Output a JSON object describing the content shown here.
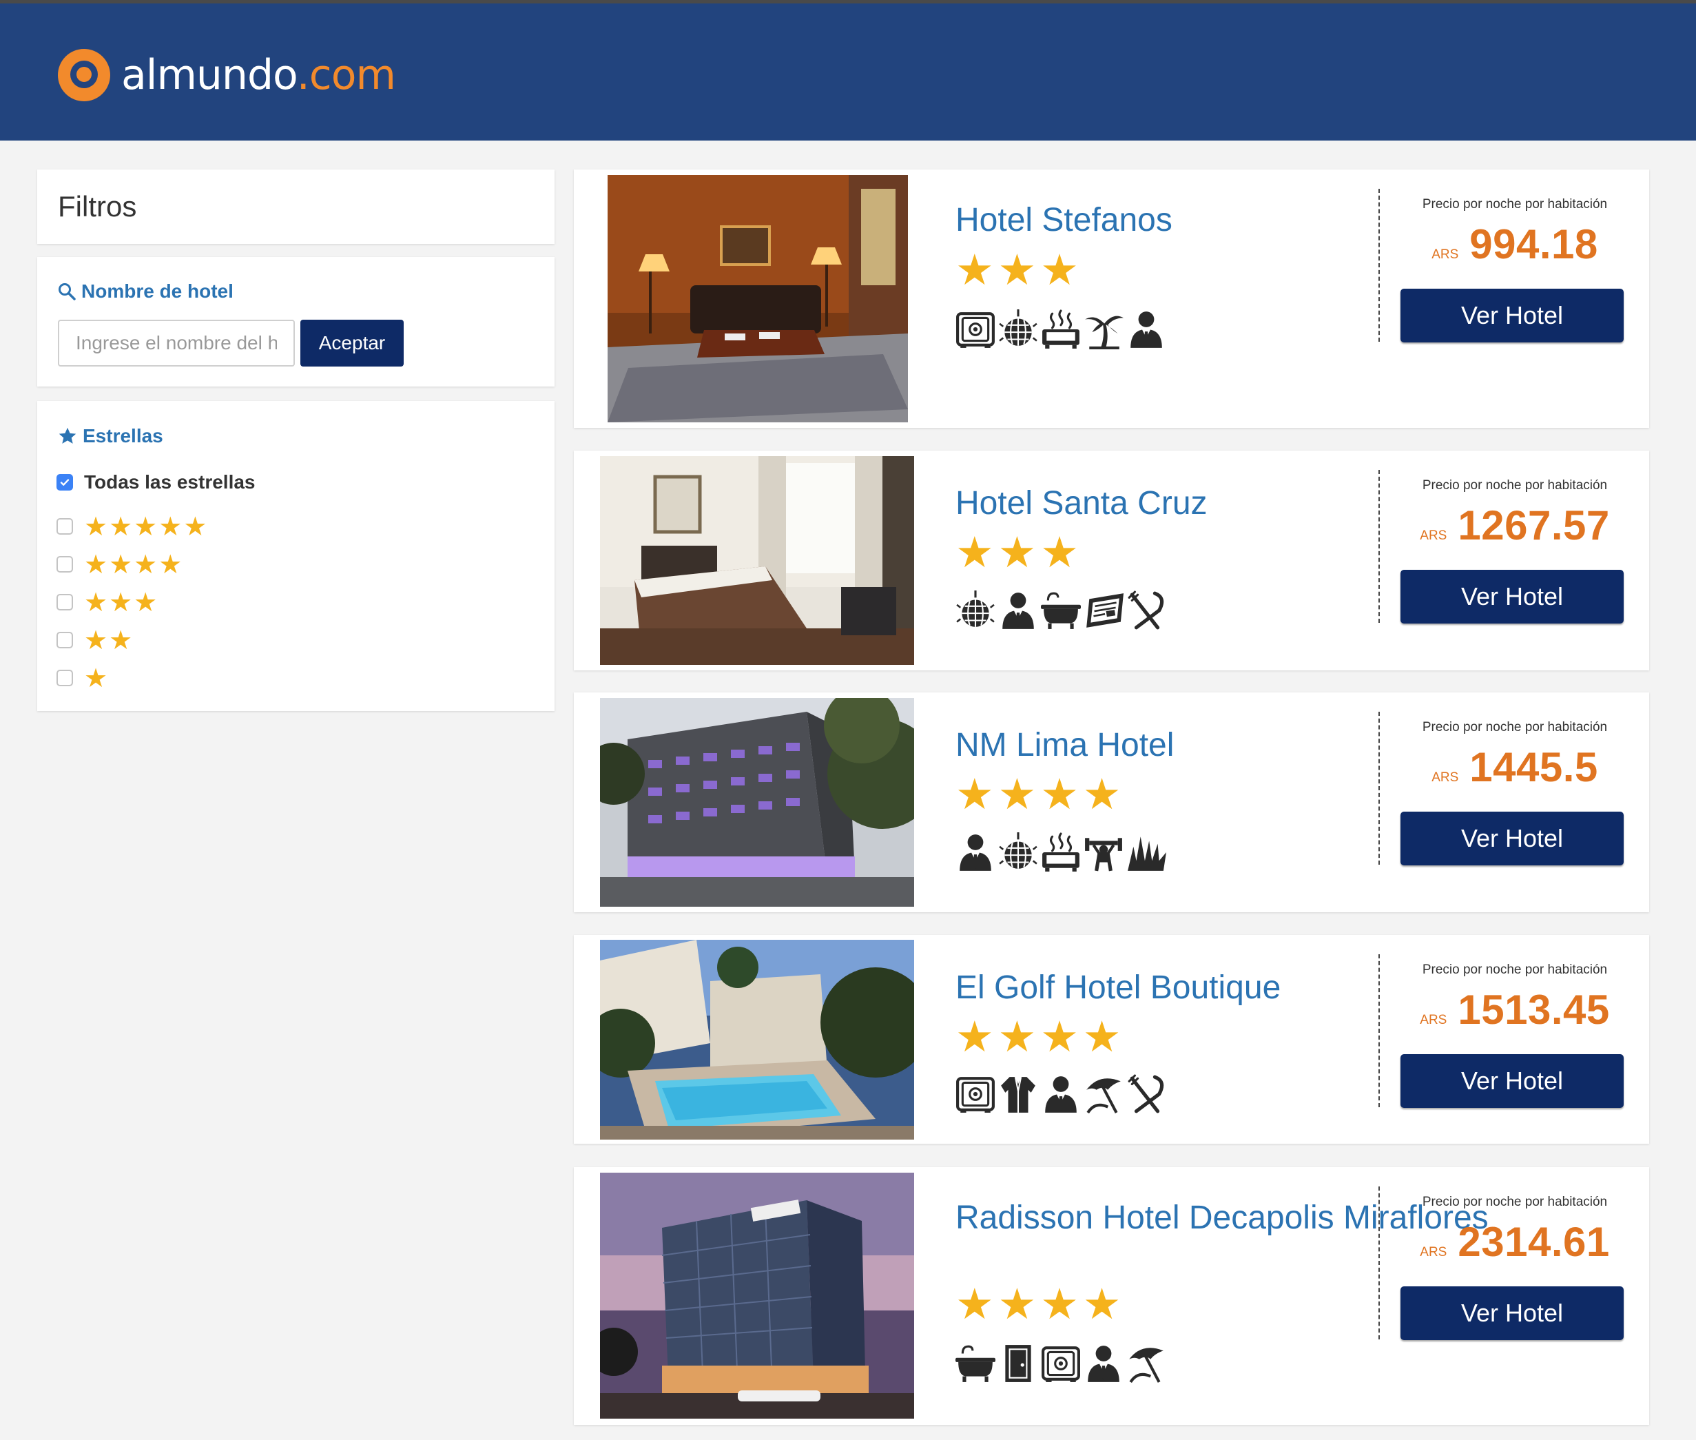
{
  "brand": {
    "logo_white": "almundo",
    "logo_orange": ".com",
    "accent": "#f28a2c",
    "header_bg": "#22447e"
  },
  "filters": {
    "title": "Filtros",
    "hotel_name": {
      "title": "Nombre de hotel",
      "placeholder": "Ingrese el nombre del hotel",
      "value": "",
      "button": "Aceptar"
    },
    "stars": {
      "title": "Estrellas",
      "all_label": "Todas las estrellas",
      "all_checked": true,
      "options": [
        {
          "stars": 5,
          "checked": false
        },
        {
          "stars": 4,
          "checked": false
        },
        {
          "stars": 3,
          "checked": false
        },
        {
          "stars": 2,
          "checked": false
        },
        {
          "stars": 1,
          "checked": false
        }
      ]
    }
  },
  "price_label": "Precio por noche por habitación",
  "button_label": "Ver Hotel",
  "hotels": [
    {
      "name": "Hotel Stefanos",
      "stars": 3,
      "currency": "ARS",
      "price": "994.18",
      "amenities": [
        "safe-icon",
        "disco-ball-icon",
        "hot-tub-icon",
        "palm-tree-icon",
        "businessman-icon"
      ]
    },
    {
      "name": "Hotel Santa Cruz",
      "stars": 3,
      "currency": "ARS",
      "price": "1267.57",
      "amenities": [
        "disco-ball-icon",
        "businessman-icon",
        "bathtub-icon",
        "newspaper-icon",
        "restaurant-icon"
      ]
    },
    {
      "name": "NM Lima Hotel",
      "stars": 4,
      "currency": "ARS",
      "price": "1445.5",
      "amenities": [
        "businessman-icon",
        "disco-ball-icon",
        "hot-tub-icon",
        "gym-icon",
        "garden-icon"
      ]
    },
    {
      "name": "El Golf Hotel Boutique",
      "stars": 4,
      "currency": "ARS",
      "price": "1513.45",
      "amenities": [
        "safe-icon",
        "bathrobe-icon",
        "businessman-icon",
        "beach-umbrella-icon",
        "restaurant-icon"
      ]
    },
    {
      "name": "Radisson Hotel Decapolis Miraflores",
      "stars": 4,
      "currency": "ARS",
      "price": "2314.61",
      "amenities": [
        "bathtub-icon",
        "door-icon",
        "safe-icon",
        "businessman-icon",
        "beach-umbrella-icon"
      ]
    }
  ]
}
